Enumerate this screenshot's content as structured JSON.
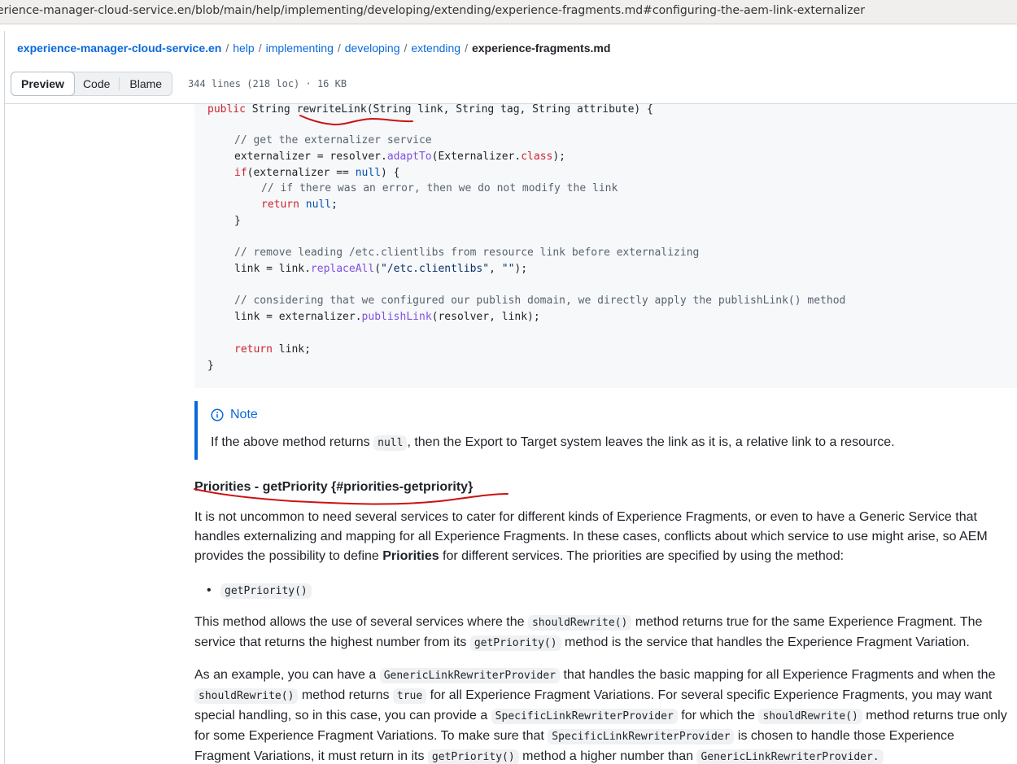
{
  "browser": {
    "url": "erience-manager-cloud-service.en/blob/main/help/implementing/developing/extending/experience-fragments.md#configuring-the-aem-link-externalizer"
  },
  "breadcrumb": {
    "repo": "experience-manager-cloud-service.en",
    "crumbs": [
      "help",
      "implementing",
      "developing",
      "extending"
    ],
    "separator": "/",
    "file": "experience-fragments.md"
  },
  "toolbar": {
    "tabs": [
      "Preview",
      "Code",
      "Blame"
    ],
    "file_info": "344 lines (218 loc) · 16 KB"
  },
  "code": {
    "sig_kw": "public",
    "sig_type": " String ",
    "sig_fn": "rewriteLink",
    "sig_args": "(String link, String tag, String attribute) {",
    "c1": "// get the externalizer service",
    "l2a": "externalizer = resolver.",
    "l2fn": "adaptTo",
    "l2b": "(Externalizer.",
    "l2kw": "class",
    "l2c": ");",
    "l3kw": "if",
    "l3a": "(externalizer == ",
    "l3nl": "null",
    "l3b": ") {",
    "c2": "// if there was an error, then we do not modify the link",
    "l5kw": "return",
    "l5nl": "null",
    "l5b": ";",
    "brace_close": "}",
    "c3": "// remove leading /etc.clientlibs from resource link before externalizing",
    "l8a": "link = link.",
    "l8fn": "replaceAll",
    "l8b": "(",
    "l8s1": "\"/etc.clientlibs\"",
    "l8c": ", ",
    "l8s2": "\"\"",
    "l8d": ");",
    "c4": "// considering that we configured our publish domain, we directly apply the publishLink() method",
    "l10a": "link = externalizer.",
    "l10fn": "publishLink",
    "l10b": "(resolver, link);",
    "l11kw": "return",
    "l11a": " link;",
    "end": "}"
  },
  "note": {
    "title": "Note",
    "text_before": "If the above method returns ",
    "code": "null",
    "text_after": ", then the Export to Target system leaves the link as it is, a relative link to a resource."
  },
  "section": {
    "heading": "Priorities - getPriority {#priorities-getpriority}",
    "p1_a": "It is not uncommon to need several services to cater for different kinds of Experience Fragments, or even to have a Generic Service that handles externalizing and mapping for all Experience Fragments. In these cases, conflicts about which service to use might arise, so AEM provides the possibility to define ",
    "p1_bold": "Priorities",
    "p1_b": " for different services. The priorities are specified by using the method:",
    "bullet_code": "getPriority()",
    "p2_a": "This method allows the use of several services where the ",
    "p2_code1": "shouldRewrite()",
    "p2_b": " method returns true for the same Experience Fragment. The service that returns the highest number from its ",
    "p2_code2": "getPriority()",
    "p2_c": " method is the service that handles the Experience Fragment Variation.",
    "p3_a": "As an example, you can have a ",
    "p3_code1": "GenericLinkRewriterProvider",
    "p3_b": " that handles the basic mapping for all Experience Fragments and when the ",
    "p3_code2": "shouldRewrite()",
    "p3_c": " method returns ",
    "p3_code3": "true",
    "p3_d": " for all Experience Fragment Variations. For several specific Experience Fragments, you may want special handling, so in this case, you can provide a ",
    "p3_code4": "SpecificLinkRewriterProvider",
    "p3_e": " for which the ",
    "p3_code5": "shouldRewrite()",
    "p3_f": " method returns true only for some Experience Fragment Variations. To make sure that ",
    "p3_code6": "SpecificLinkRewriterProvider",
    "p3_g": " is chosen to handle those Experience Fragment Variations, it must return in its ",
    "p3_code7": "getPriority()",
    "p3_h": " method a higher number than ",
    "p3_code8": "GenericLinkRewriterProvider."
  },
  "colors": {
    "link": "#0969da",
    "annotation": "#cc1111",
    "code_bg": "#f6f8fa",
    "keyword": "#cf222e",
    "function": "#8250df"
  }
}
